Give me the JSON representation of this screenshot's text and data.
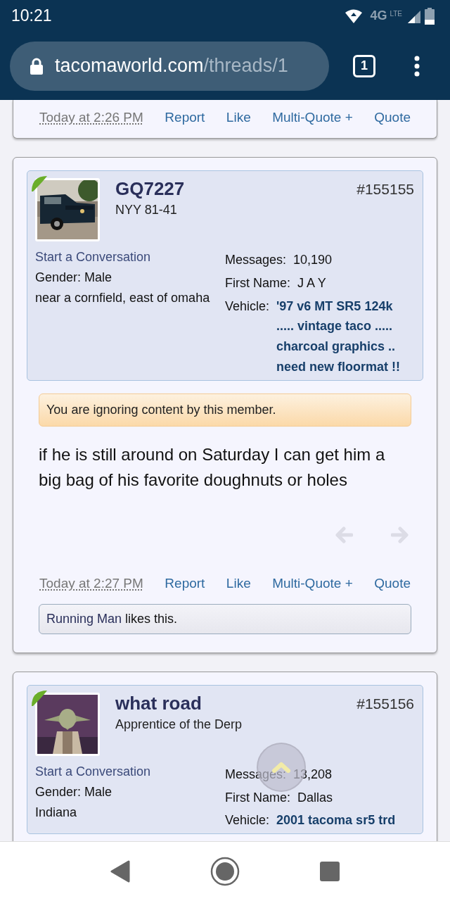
{
  "status_bar": {
    "time": "10:21",
    "network": "4G",
    "network_sub": "LTE"
  },
  "browser": {
    "url_host": "tacomaworld.com",
    "url_path": "/threads/1",
    "tab_count": "1"
  },
  "posts": [
    {
      "footer": {
        "time": "Today at 2:26 PM",
        "actions": [
          "Report",
          "Like",
          "Multi-Quote +",
          "Quote"
        ]
      }
    },
    {
      "user": {
        "name": "GQ7227",
        "title": "NYY 81-41",
        "number": "#155155",
        "start_conversation": "Start a Conversation",
        "gender": "Gender:  Male",
        "location": "near a cornfield, east of omaha",
        "stats": [
          {
            "label": "Messages:",
            "value": "10,190",
            "kind": "plain"
          },
          {
            "label": "First Name:",
            "value": "J A Y",
            "kind": "plain"
          },
          {
            "label": "Vehicle:",
            "value": "'97 v6 MT SR5 124k ..... vintage taco ..... charcoal graphics .. need new floormat !!",
            "kind": "link"
          }
        ]
      },
      "ignored_notice": "You are ignoring content by this member.",
      "message": "if he is still around on Saturday I can get him a big bag of his favorite doughnuts or holes",
      "footer": {
        "time": "Today at 2:27 PM",
        "actions": [
          "Report",
          "Like",
          "Multi-Quote +",
          "Quote"
        ]
      },
      "likes": {
        "names": "Running Man",
        "text": "likes this."
      }
    },
    {
      "user": {
        "name": "what road",
        "title": "Apprentice of the Derp",
        "number": "#155156",
        "start_conversation": "Start a Conversation",
        "gender": "Gender:  Male",
        "location": "Indiana",
        "stats": [
          {
            "label": "Messages:",
            "value": "13,208",
            "kind": "plain"
          },
          {
            "label": "First Name:",
            "value": "Dallas",
            "kind": "plain"
          },
          {
            "label": "Vehicle:",
            "value": "2001 tacoma sr5 trd",
            "kind": "link"
          }
        ]
      }
    }
  ]
}
